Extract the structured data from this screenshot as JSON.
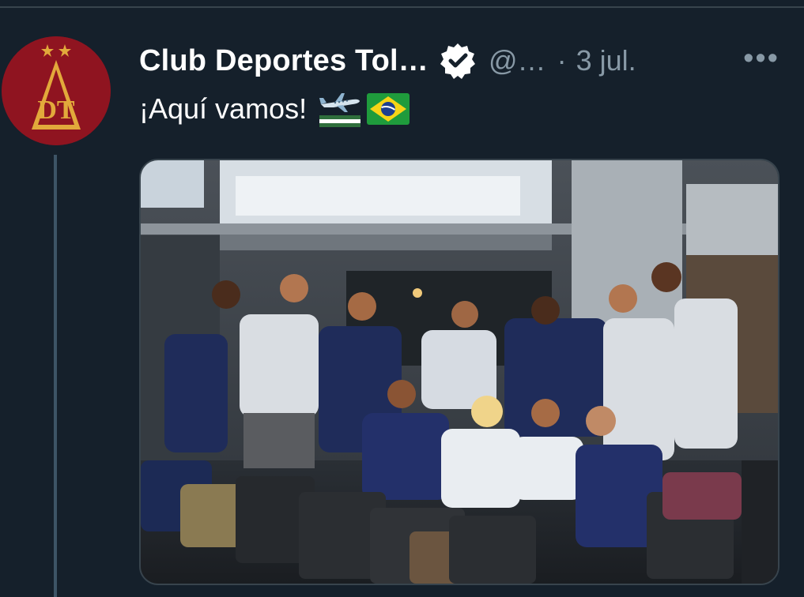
{
  "tweet": {
    "author_name": "Club Deportes Tol…",
    "handle": "@…",
    "separator": "·",
    "date": "3 jul.",
    "more_label": "•••",
    "text": "¡Aquí vamos!",
    "emojis": [
      "airplane-icon",
      "tolima-flag-icon",
      "brazil-flag-icon"
    ],
    "media_description": "team-photo"
  },
  "colors": {
    "background": "#15202b",
    "text_primary": "#ffffff",
    "text_secondary": "#8899a6",
    "divider": "#38444d",
    "avatar_red": "#8f1420",
    "crest_gold": "#e2a93b"
  }
}
